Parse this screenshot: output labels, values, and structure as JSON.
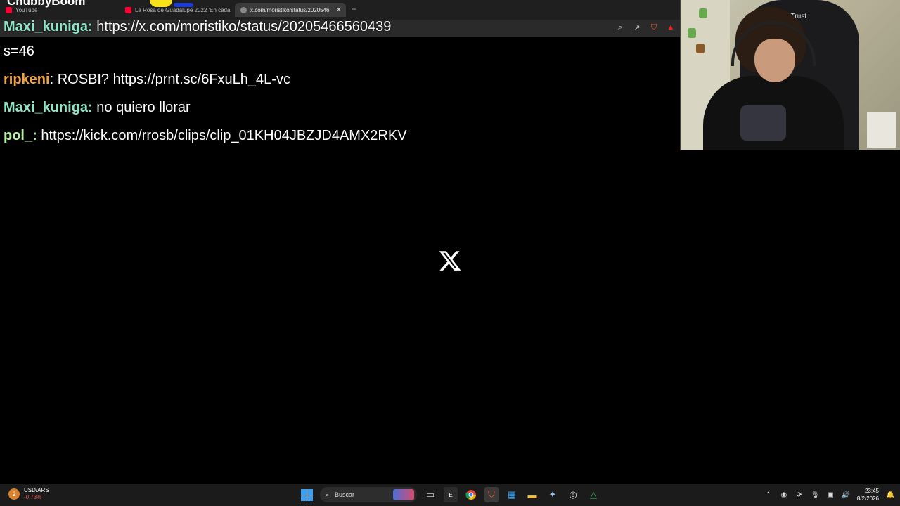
{
  "browser": {
    "tabs": [
      {
        "label": "YouTube",
        "color": "#ff0033"
      },
      {
        "label": "La Rosa de Guadalupe 2022 'En cada",
        "color": "#ff0033"
      },
      {
        "label": "x.com/moristiko/status/2020546",
        "color": "#888888"
      }
    ],
    "new_tab_symbol": "+",
    "stream_title": "ChubbyBoom"
  },
  "chat": {
    "messages": [
      {
        "user": "Maxi_kuniga",
        "text": " https://x.com/moristiko/status/20205466560439",
        "color": "#8fe3c6"
      },
      {
        "user": "",
        "text": "s=46",
        "color": "#ffffff"
      },
      {
        "user": "ripkeni",
        "text": " ROSBI? https://prnt.sc/6FxuLh_4L-vc",
        "color": "#f0a33c"
      },
      {
        "user": "Maxi_kuniga",
        "text": " no quiero llorar",
        "color": "#8fe3c6"
      },
      {
        "user": "pol_",
        "text": " https://kick.com/rrosb/clips/clip_01KH04JBZJD4AMX2RKV",
        "color": "#b7f0a0"
      }
    ],
    "colon": ":"
  },
  "webcam": {
    "chair_brand": "XTrust"
  },
  "taskbar": {
    "ticker_label": "USD/ARS",
    "ticker_value": "-0,73%",
    "ticker_badge": "2",
    "search_placeholder": "Buscar",
    "time": "23:45",
    "date": "8/2/2026"
  }
}
